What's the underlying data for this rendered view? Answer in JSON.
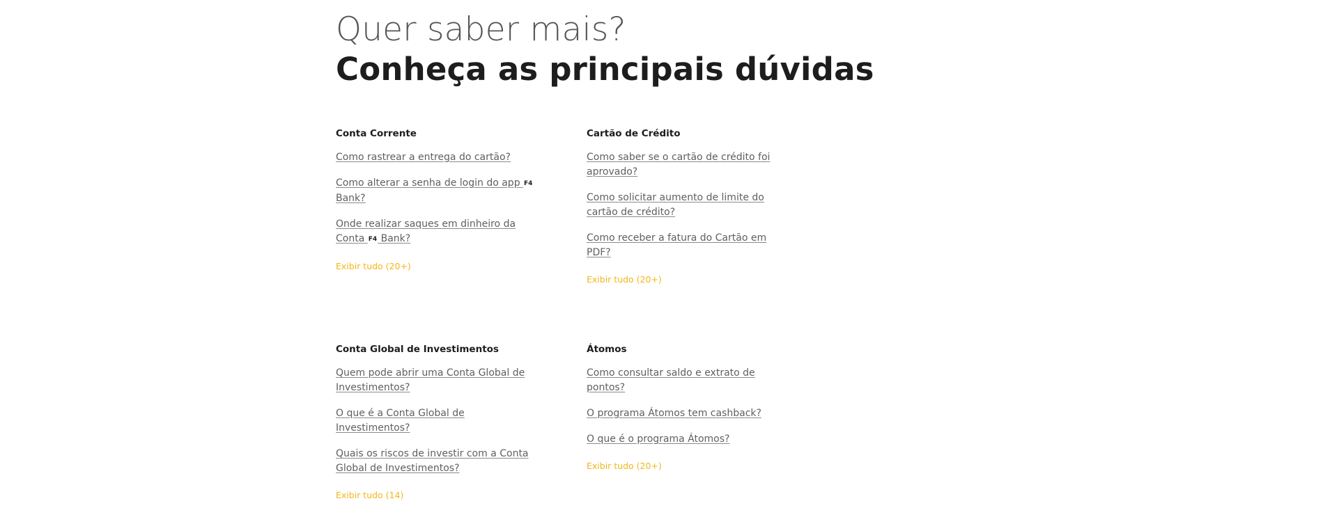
{
  "intro": {
    "line1": "Quer saber mais?",
    "line2": "Conheça as principais dúvidas"
  },
  "brand_mark": "F4",
  "sections": [
    {
      "title": "Conta Corrente",
      "questions": [
        {
          "before": "Como rastrear a entrega do cartão?",
          "after": ""
        },
        {
          "before": "Como alterar a senha de login do app",
          "after": " Bank?"
        },
        {
          "before": "Onde realizar saques em dinheiro da Conta",
          "after": " Bank?"
        }
      ],
      "more": "Exibir tudo (20+)"
    },
    {
      "title": "Cartão de Crédito",
      "questions": [
        {
          "before": "Como saber se o cartão de crédito foi aprovado?",
          "after": ""
        },
        {
          "before": "Como solicitar aumento de limite do cartão de crédito?",
          "after": ""
        },
        {
          "before": "Como receber a fatura do Cartão em PDF?",
          "after": ""
        }
      ],
      "more": "Exibir tudo (20+)"
    },
    {
      "title": "Conta Global de Investimentos",
      "questions": [
        {
          "before": "Quem pode abrir uma Conta Global de Investimentos?",
          "after": ""
        },
        {
          "before": "O que é a Conta Global de Investimentos?",
          "after": ""
        },
        {
          "before": "Quais os riscos de investir com a Conta Global de Investimentos?",
          "after": ""
        }
      ],
      "more": "Exibir tudo (14)"
    },
    {
      "title": "Átomos",
      "questions": [
        {
          "before": "Como consultar saldo e extrato de pontos?",
          "after": ""
        },
        {
          "before": "O programa Átomos tem cashback?",
          "after": ""
        },
        {
          "before": "O que é o programa Átomos?",
          "after": ""
        }
      ],
      "more": "Exibir tudo (20+)"
    }
  ],
  "colors": {
    "accent": "#f2b619",
    "link": "#5f5f5f",
    "heading": "#1d1d1d",
    "subheading": "#555555"
  }
}
